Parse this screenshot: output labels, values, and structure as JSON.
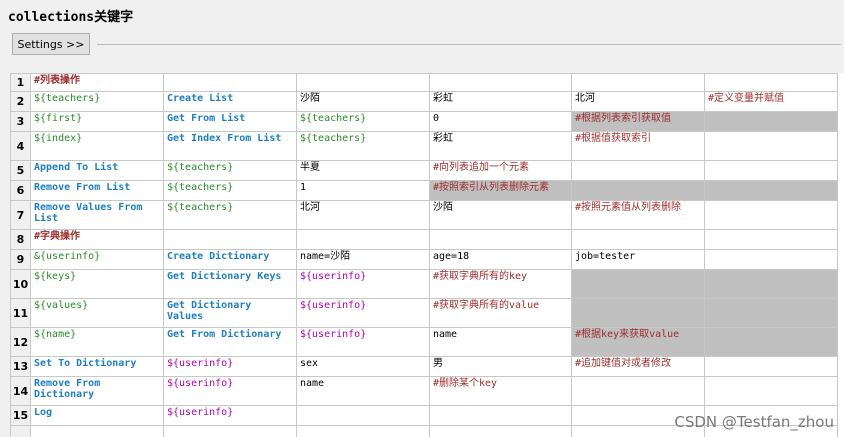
{
  "title": "collections关键字",
  "settings_button": "Settings >>",
  "watermark": "CSDN @Testfan_zhou",
  "rows": [
    {
      "num": "1",
      "c1": {
        "t": "#列表操作",
        "k": "hdr"
      },
      "c2": {
        "t": "",
        "k": ""
      },
      "c3": {
        "t": "",
        "k": ""
      },
      "c4": {
        "t": "",
        "k": ""
      },
      "c5": {
        "t": "",
        "k": ""
      },
      "c6": {
        "t": "",
        "k": ""
      }
    },
    {
      "num": "2",
      "c1": {
        "t": "${teachers}",
        "k": "var"
      },
      "c2": {
        "t": "Create List",
        "k": "kw"
      },
      "c3": {
        "t": "沙陌",
        "k": "val"
      },
      "c4": {
        "t": "彩虹",
        "k": "val"
      },
      "c5": {
        "t": "北河",
        "k": "val"
      },
      "c6": {
        "t": "#定义变量并赋值",
        "k": "cm"
      }
    },
    {
      "num": "3",
      "c1": {
        "t": "${first}",
        "k": "var"
      },
      "c2": {
        "t": "Get From List",
        "k": "kw"
      },
      "c3": {
        "t": "${teachers}",
        "k": "var"
      },
      "c4": {
        "t": "0",
        "k": "val"
      },
      "c5": {
        "t": "#根据列表索引获取值",
        "k": "cm gray"
      },
      "c6": {
        "t": "",
        "k": "gray"
      }
    },
    {
      "num": "4",
      "c1": {
        "t": "${index}",
        "k": "var"
      },
      "c2": {
        "t": "Get Index From List",
        "k": "kw"
      },
      "c3": {
        "t": "${teachers}",
        "k": "var"
      },
      "c4": {
        "t": "彩虹",
        "k": "val"
      },
      "c5": {
        "t": "#根据值获取索引",
        "k": "cm"
      },
      "c6": {
        "t": "",
        "k": ""
      }
    },
    {
      "num": "5",
      "c1": {
        "t": "Append To List",
        "k": "kw"
      },
      "c2": {
        "t": "${teachers}",
        "k": "var"
      },
      "c3": {
        "t": "半夏",
        "k": "val"
      },
      "c4": {
        "t": "#向列表追加一个元素",
        "k": "cm"
      },
      "c5": {
        "t": "",
        "k": ""
      },
      "c6": {
        "t": "",
        "k": ""
      }
    },
    {
      "num": "6",
      "c1": {
        "t": "Remove From List",
        "k": "kw"
      },
      "c2": {
        "t": "${teachers}",
        "k": "var"
      },
      "c3": {
        "t": "1",
        "k": "val"
      },
      "c4": {
        "t": "#按照索引从列表删除元素",
        "k": "cm gray"
      },
      "c5": {
        "t": "",
        "k": "gray"
      },
      "c6": {
        "t": "",
        "k": "gray"
      }
    },
    {
      "num": "7",
      "c1": {
        "t": "Remove Values From List",
        "k": "kw"
      },
      "c2": {
        "t": "${teachers}",
        "k": "var"
      },
      "c3": {
        "t": "北河",
        "k": "val"
      },
      "c4": {
        "t": "沙陌",
        "k": "val"
      },
      "c5": {
        "t": "#按照元素值从列表删除",
        "k": "cm"
      },
      "c6": {
        "t": "",
        "k": ""
      }
    },
    {
      "num": "8",
      "c1": {
        "t": "#字典操作",
        "k": "hdr"
      },
      "c2": {
        "t": "",
        "k": ""
      },
      "c3": {
        "t": "",
        "k": ""
      },
      "c4": {
        "t": "",
        "k": ""
      },
      "c5": {
        "t": "",
        "k": ""
      },
      "c6": {
        "t": "",
        "k": ""
      }
    },
    {
      "num": "9",
      "c1": {
        "t": "&{userinfo}",
        "k": "var"
      },
      "c2": {
        "t": "Create Dictionary",
        "k": "kw"
      },
      "c3": {
        "t": "name=沙陌",
        "k": "val"
      },
      "c4": {
        "t": "age=18",
        "k": "val"
      },
      "c5": {
        "t": "job=tester",
        "k": "val"
      },
      "c6": {
        "t": "",
        "k": ""
      }
    },
    {
      "num": "10",
      "c1": {
        "t": "${keys}",
        "k": "var"
      },
      "c2": {
        "t": "Get Dictionary Keys",
        "k": "kw"
      },
      "c3": {
        "t": "${userinfo}",
        "k": "vp"
      },
      "c4": {
        "t": "#获取字典所有的key",
        "k": "cm"
      },
      "c5": {
        "t": "",
        "k": "gray"
      },
      "c6": {
        "t": "",
        "k": "gray"
      }
    },
    {
      "num": "11",
      "c1": {
        "t": "${values}",
        "k": "var"
      },
      "c2": {
        "t": "Get Dictionary Values",
        "k": "kw"
      },
      "c3": {
        "t": "${userinfo}",
        "k": "vp"
      },
      "c4": {
        "t": "#获取字典所有的value",
        "k": "cm"
      },
      "c5": {
        "t": "",
        "k": "gray"
      },
      "c6": {
        "t": "",
        "k": "gray"
      }
    },
    {
      "num": "12",
      "c1": {
        "t": "${name}",
        "k": "var"
      },
      "c2": {
        "t": "Get From Dictionary",
        "k": "kw"
      },
      "c3": {
        "t": "${userinfo}",
        "k": "vp"
      },
      "c4": {
        "t": "name",
        "k": "val"
      },
      "c5": {
        "t": "#根据key来获取value",
        "k": "cm gray"
      },
      "c6": {
        "t": "",
        "k": "gray"
      }
    },
    {
      "num": "13",
      "c1": {
        "t": "Set To Dictionary",
        "k": "kw"
      },
      "c2": {
        "t": "${userinfo}",
        "k": "vp"
      },
      "c3": {
        "t": "sex",
        "k": "val"
      },
      "c4": {
        "t": "男",
        "k": "val"
      },
      "c5": {
        "t": "#追加键值对或者修改",
        "k": "cm"
      },
      "c6": {
        "t": "",
        "k": ""
      }
    },
    {
      "num": "14",
      "c1": {
        "t": "Remove From Dictionary",
        "k": "kw"
      },
      "c2": {
        "t": "${userinfo}",
        "k": "vp"
      },
      "c3": {
        "t": "name",
        "k": "val"
      },
      "c4": {
        "t": "#删除某个key",
        "k": "cm"
      },
      "c5": {
        "t": "",
        "k": ""
      },
      "c6": {
        "t": "",
        "k": ""
      }
    },
    {
      "num": "15",
      "c1": {
        "t": "Log",
        "k": "kw"
      },
      "c2": {
        "t": "${userinfo}",
        "k": "vp"
      },
      "c3": {
        "t": "",
        "k": ""
      },
      "c4": {
        "t": "",
        "k": ""
      },
      "c5": {
        "t": "",
        "k": ""
      },
      "c6": {
        "t": "",
        "k": ""
      }
    },
    {
      "num": "",
      "c1": {
        "t": "",
        "k": ""
      },
      "c2": {
        "t": "",
        "k": ""
      },
      "c3": {
        "t": "",
        "k": ""
      },
      "c4": {
        "t": "",
        "k": ""
      },
      "c5": {
        "t": "",
        "k": ""
      },
      "c6": {
        "t": "",
        "k": ""
      }
    }
  ]
}
